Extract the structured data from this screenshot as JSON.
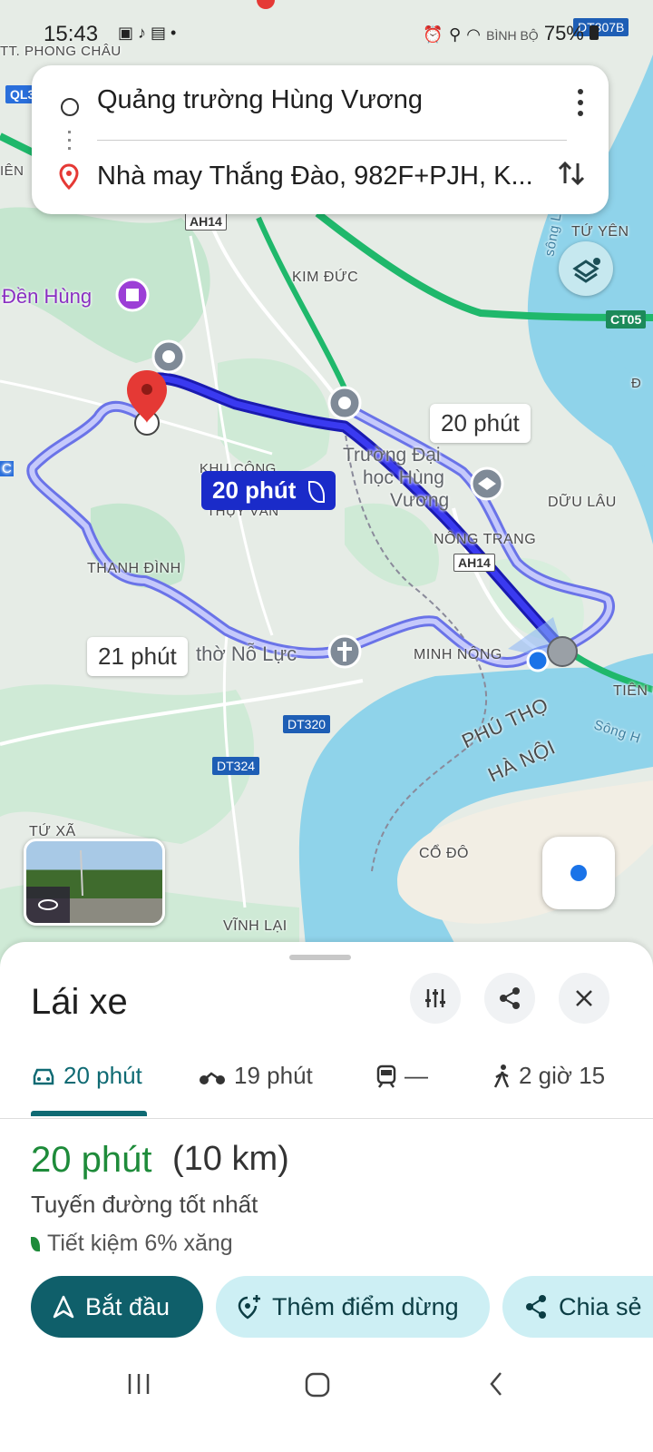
{
  "status_bar": {
    "time": "15:43",
    "battery": "75%",
    "map_corner_label": "BÌNH BỘ"
  },
  "search": {
    "origin": "Quảng trường Hùng Vương",
    "destination": "Nhà may Thắng Đào, 982F+PJH, K..."
  },
  "map": {
    "labels": {
      "tt_phong_chau": "TT. PHONG CHÂU",
      "kim_duc": "KIM ĐỨC",
      "tu_yen": "TỨ YÊN",
      "khu_cong": "KHU CÔNG",
      "thuy_van": "THỤY VÂN",
      "thanh_dinh": "THANH ĐÌNH",
      "nong_trang": "NÔNG TRANG",
      "minh_nong": "MINH NÔNG",
      "duu_lau": "DỮU LÂU",
      "tien_cat": "TIÊN C",
      "tu_xa": "TỨ XÃ",
      "co_do": "CỔ ĐÔ",
      "vinh_lai": "VĨNH LẠI",
      "phu_tho": "PHÚ THỌ",
      "ha_noi": "HÀ NỘI",
      "song_hong": "Sông H",
      "song_lo": "sông L",
      "ien": "IÊN",
      "left_c": "C",
      "right_d": "Đ"
    },
    "pois": {
      "den_hung": "Đền Hùng",
      "truong": "Trường Đại học Hùng Vương",
      "truong_line1": "Trường Đại",
      "truong_line2": "học Hùng",
      "truong_line3": "Vương",
      "nha_tho": "thờ Nỗ Lực"
    },
    "shields": {
      "dt307b": "DT307B",
      "ql3": "QL3",
      "ah14_top": "AH14",
      "ah14_mid": "AH14",
      "ct05": "CT05",
      "dt320": "DT320",
      "dt324": "DT324"
    },
    "route_times": {
      "main": "20 phút",
      "alt_right": "20 phút",
      "alt_left": "21 phút"
    }
  },
  "sheet": {
    "title": "Lái xe",
    "tabs": [
      {
        "label": "20 phút",
        "icon": "car-icon",
        "active": true
      },
      {
        "label": "19 phút",
        "icon": "motorbike-icon",
        "active": false
      },
      {
        "label": "—",
        "icon": "train-icon",
        "active": false
      },
      {
        "label": "2 giờ 15",
        "icon": "walk-icon",
        "active": false
      }
    ],
    "summary_time": "20 phút",
    "summary_distance": "(10 km)",
    "route_desc": "Tuyến đường tốt nhất",
    "fuel_saving": "Tiết kiệm 6% xăng",
    "actions": {
      "start": "Bắt đầu",
      "add_stop": "Thêm điểm dừng",
      "share": "Chia sẻ"
    }
  },
  "colors": {
    "route_main": "#1a2bc9",
    "route_alt": "#8f96f0",
    "accent_teal": "#0f5f6a",
    "time_green": "#1e8b3a",
    "highway_green": "#1fb86b",
    "water": "#8fd3ea"
  }
}
